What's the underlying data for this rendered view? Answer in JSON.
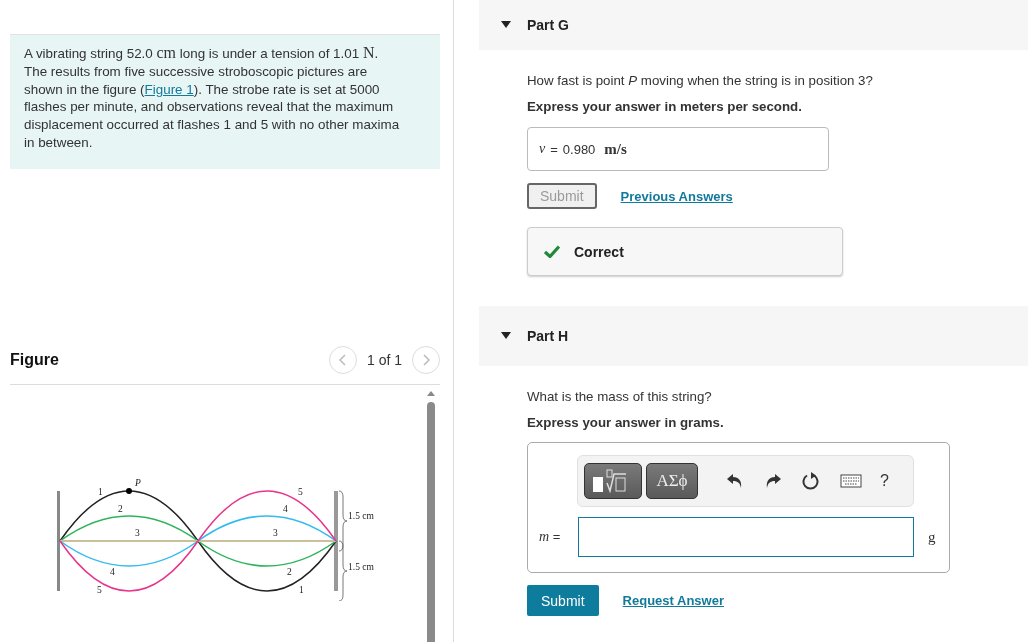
{
  "problem": {
    "segments": [
      {
        "kind": "text",
        "text": "A vibrating string 52.0 "
      },
      {
        "kind": "math",
        "text": "cm"
      },
      {
        "kind": "text",
        "text": " long is under a tension of 1.01 "
      },
      {
        "kind": "math",
        "text": "N"
      },
      {
        "kind": "text",
        "text": ". The results from five successive stroboscopic pictures are shown in the figure ("
      },
      {
        "kind": "link",
        "text": "Figure 1"
      },
      {
        "kind": "text",
        "text": "). The strobe rate is set at 5000 flashes per minute, and observations reveal that the maximum displacement occurred at flashes 1 and 5 with no other maxima in between."
      }
    ]
  },
  "figure": {
    "title": "Figure",
    "pager": "1 of 1",
    "point_label": "P",
    "scale_labels": [
      "1.5 cm",
      "1.5 cm"
    ],
    "curves": [
      {
        "left_label": "1",
        "right_label": "1",
        "color": "#222222"
      },
      {
        "left_label": "2",
        "right_label": "2",
        "color": "#2eb35a"
      },
      {
        "left_label": "3",
        "right_label": "3",
        "color": "#cbbf9c"
      },
      {
        "left_label": "4",
        "right_label": "4",
        "color": "#33bbee"
      },
      {
        "left_label": "5",
        "right_label": "5",
        "color": "#e8348c"
      }
    ]
  },
  "part_g": {
    "title": "Part G",
    "expanded": true,
    "question": "How fast is point *P* moving when the string is in position 3?",
    "instruction": "Express your answer in meters per second.",
    "answer": {
      "variable": "v",
      "equals": "=",
      "value": "0.980",
      "unit": "m/s"
    },
    "submit": {
      "label": "Submit",
      "disabled": true
    },
    "link": "Previous Answers",
    "feedback": "Correct"
  },
  "part_h": {
    "title": "Part H",
    "expanded": true,
    "question": "What is the mass of this string?",
    "instruction": "Express your answer in grams.",
    "toolbar": {
      "symbols": "ΑΣϕ",
      "help": "?"
    },
    "answer": {
      "variable": "m",
      "equals": "=",
      "unit": "g"
    },
    "submit": {
      "label": "Submit",
      "disabled": false
    },
    "link": "Request Answer"
  }
}
